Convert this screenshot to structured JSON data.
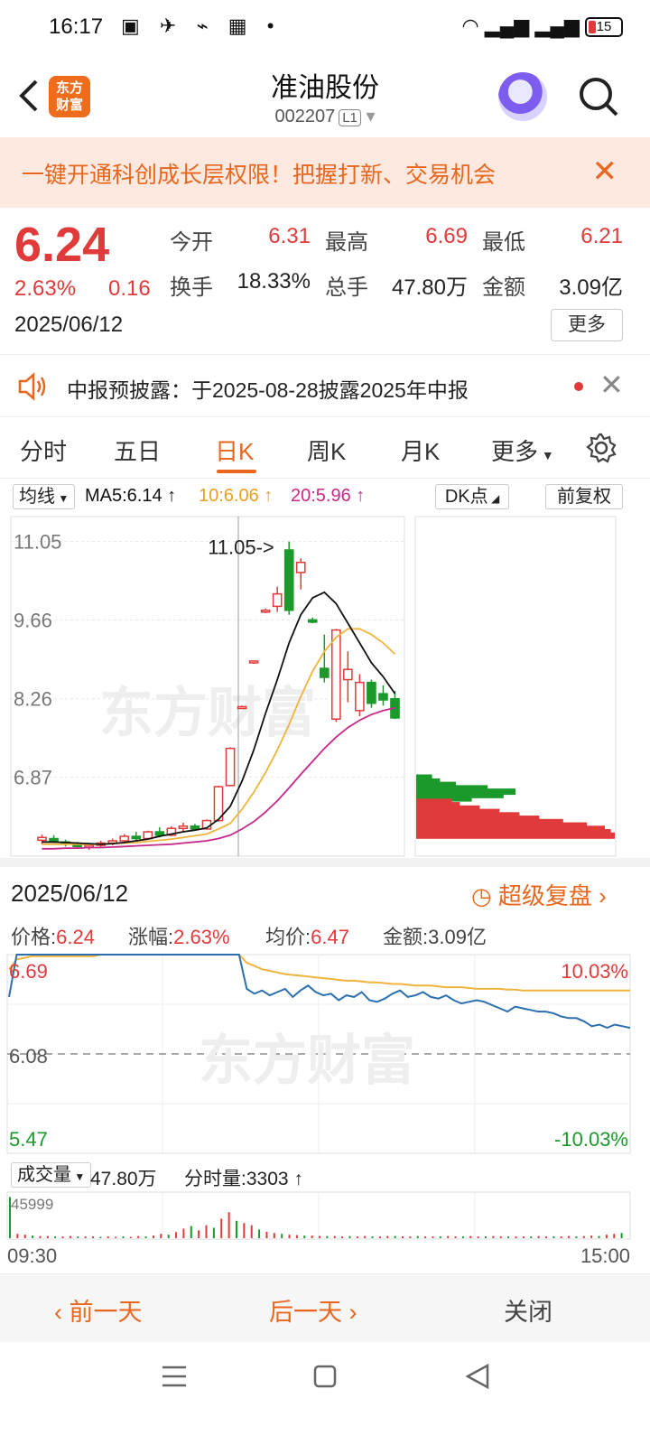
{
  "status_bar": {
    "time": "16:17",
    "battery": "15"
  },
  "header": {
    "title": "准油股份",
    "code": "002207",
    "level": "L1",
    "logo_text": "东方财富"
  },
  "banner": {
    "text": "一键开通科创成长层权限！把握打新、交易机会"
  },
  "quote": {
    "price": "6.24",
    "change_pct": "2.63%",
    "change": "0.16",
    "date": "2025/06/12",
    "open_label": "今开",
    "open": "6.31",
    "high_label": "最高",
    "high": "6.69",
    "low_label": "最低",
    "low": "6.21",
    "turnover_label": "换手",
    "turnover": "18.33%",
    "volume_label": "总手",
    "volume": "47.80万",
    "amount_label": "金额",
    "amount": "3.09亿",
    "more": "更多"
  },
  "notice": {
    "text": "中报预披露：于2025-08-28披露2025年中报"
  },
  "tabs": [
    {
      "label": "分时"
    },
    {
      "label": "五日"
    },
    {
      "label": "日K"
    },
    {
      "label": "周K"
    },
    {
      "label": "月K"
    },
    {
      "label": "更多"
    }
  ],
  "kline_toolbar": {
    "ma_select": "均线",
    "ma5": "MA5:6.14",
    "ma10": "10:6.06",
    "ma20": "20:5.96",
    "dk": "DK点",
    "adjust": "前复权"
  },
  "colors": {
    "up": "#e03a3a",
    "down": "#1b9a2b",
    "accent": "#e8661e",
    "ma5": "#111111",
    "ma10": "#f0b43c",
    "ma20": "#c8288c"
  },
  "chart_data": [
    {
      "type": "candlestick",
      "y_ticks": [
        "11.05",
        "9.66",
        "8.26",
        "6.87"
      ],
      "max_annotation": "11.05->",
      "ylim": [
        5.5,
        11.3
      ],
      "candles": [
        {
          "o": 5.75,
          "h": 5.85,
          "l": 5.68,
          "c": 5.8
        },
        {
          "o": 5.78,
          "h": 5.84,
          "l": 5.7,
          "c": 5.72
        },
        {
          "o": 5.72,
          "h": 5.76,
          "l": 5.64,
          "c": 5.68
        },
        {
          "o": 5.68,
          "h": 5.72,
          "l": 5.6,
          "c": 5.64
        },
        {
          "o": 5.64,
          "h": 5.7,
          "l": 5.58,
          "c": 5.66
        },
        {
          "o": 5.66,
          "h": 5.74,
          "l": 5.62,
          "c": 5.7
        },
        {
          "o": 5.7,
          "h": 5.78,
          "l": 5.66,
          "c": 5.74
        },
        {
          "o": 5.74,
          "h": 5.86,
          "l": 5.7,
          "c": 5.82
        },
        {
          "o": 5.82,
          "h": 5.9,
          "l": 5.74,
          "c": 5.78
        },
        {
          "o": 5.78,
          "h": 5.92,
          "l": 5.76,
          "c": 5.9
        },
        {
          "o": 5.9,
          "h": 5.98,
          "l": 5.8,
          "c": 5.84
        },
        {
          "o": 5.84,
          "h": 6.0,
          "l": 5.82,
          "c": 5.96
        },
        {
          "o": 5.96,
          "h": 6.06,
          "l": 5.9,
          "c": 6.0
        },
        {
          "o": 6.0,
          "h": 6.04,
          "l": 5.92,
          "c": 5.95
        },
        {
          "o": 5.95,
          "h": 6.12,
          "l": 5.94,
          "c": 6.1
        },
        {
          "o": 6.1,
          "h": 6.72,
          "l": 6.08,
          "c": 6.7
        },
        {
          "o": 6.72,
          "h": 7.4,
          "l": 6.72,
          "c": 7.38
        },
        {
          "o": 8.12,
          "h": 8.14,
          "l": 8.1,
          "c": 8.12
        },
        {
          "o": 8.9,
          "h": 8.94,
          "l": 8.88,
          "c": 8.93
        },
        {
          "o": 9.8,
          "h": 9.86,
          "l": 9.78,
          "c": 9.83
        },
        {
          "o": 9.9,
          "h": 10.25,
          "l": 9.8,
          "c": 10.12
        },
        {
          "o": 10.9,
          "h": 11.05,
          "l": 9.75,
          "c": 9.83
        },
        {
          "o": 10.5,
          "h": 10.75,
          "l": 10.2,
          "c": 10.68
        },
        {
          "o": 9.66,
          "h": 9.7,
          "l": 9.6,
          "c": 9.62
        },
        {
          "o": 8.8,
          "h": 9.4,
          "l": 8.55,
          "c": 8.64
        },
        {
          "o": 7.9,
          "h": 9.5,
          "l": 7.85,
          "c": 9.48
        },
        {
          "o": 8.6,
          "h": 9.1,
          "l": 8.2,
          "c": 8.78
        },
        {
          "o": 8.05,
          "h": 8.7,
          "l": 7.95,
          "c": 8.55
        },
        {
          "o": 8.55,
          "h": 8.6,
          "l": 8.1,
          "c": 8.18
        },
        {
          "o": 8.35,
          "h": 8.5,
          "l": 8.14,
          "c": 8.24
        },
        {
          "o": 8.26,
          "h": 8.4,
          "l": 7.9,
          "c": 7.92
        }
      ],
      "ma5": [
        5.72,
        5.72,
        5.71,
        5.7,
        5.69,
        5.68,
        5.69,
        5.71,
        5.74,
        5.77,
        5.82,
        5.86,
        5.9,
        5.93,
        5.97,
        6.12,
        6.35,
        6.8,
        7.35,
        8.0,
        8.6,
        9.25,
        9.75,
        10.05,
        10.15,
        9.95,
        9.6,
        9.25,
        8.9,
        8.65,
        8.35
      ],
      "ma10": [
        5.68,
        5.68,
        5.68,
        5.68,
        5.68,
        5.68,
        5.69,
        5.7,
        5.71,
        5.73,
        5.75,
        5.77,
        5.8,
        5.83,
        5.86,
        5.95,
        6.05,
        6.3,
        6.6,
        6.95,
        7.35,
        7.8,
        8.3,
        8.75,
        9.1,
        9.35,
        9.5,
        9.5,
        9.4,
        9.25,
        9.05
      ],
      "ma20": [
        5.6,
        5.6,
        5.61,
        5.61,
        5.62,
        5.62,
        5.63,
        5.64,
        5.65,
        5.66,
        5.67,
        5.68,
        5.7,
        5.72,
        5.74,
        5.78,
        5.84,
        5.95,
        6.08,
        6.25,
        6.45,
        6.68,
        6.92,
        7.15,
        7.38,
        7.58,
        7.75,
        7.88,
        7.98,
        8.05,
        8.1
      ]
    },
    {
      "type": "line",
      "price_label": "价格:",
      "price": "6.24",
      "change_label": "涨幅:",
      "change": "2.63%",
      "avg_label": "均价:",
      "avg": "6.47",
      "amount_label": "金额:",
      "amount": "3.09亿",
      "y_left": [
        "6.69",
        "6.08",
        "5.47"
      ],
      "y_right": [
        "10.03%",
        "-10.03%"
      ],
      "ylim": [
        5.47,
        6.69
      ],
      "x_start": "09:30",
      "x_end": "15:00",
      "price_series": [
        6.43,
        6.69,
        6.69,
        6.69,
        6.69,
        6.69,
        6.69,
        6.69,
        6.69,
        6.69,
        6.69,
        6.69,
        6.69,
        6.69,
        6.69,
        6.69,
        6.69,
        6.69,
        6.69,
        6.69,
        6.69,
        6.69,
        6.69,
        6.69,
        6.69,
        6.69,
        6.69,
        6.69,
        6.69,
        6.69,
        6.69,
        6.48,
        6.45,
        6.47,
        6.44,
        6.46,
        6.48,
        6.43,
        6.47,
        6.5,
        6.46,
        6.44,
        6.45,
        6.41,
        6.44,
        6.43,
        6.46,
        6.41,
        6.4,
        6.42,
        6.45,
        6.47,
        6.43,
        6.44,
        6.46,
        6.43,
        6.42,
        6.44,
        6.41,
        6.39,
        6.4,
        6.41,
        6.4,
        6.38,
        6.36,
        6.34,
        6.37,
        6.36,
        6.35,
        6.34,
        6.34,
        6.33,
        6.31,
        6.3,
        6.3,
        6.28,
        6.25,
        6.26,
        6.24,
        6.26,
        6.25,
        6.24
      ],
      "avg_series": [
        6.6,
        6.66,
        6.67,
        6.68,
        6.68,
        6.68,
        6.68,
        6.68,
        6.68,
        6.68,
        6.68,
        6.68,
        6.69,
        6.69,
        6.69,
        6.69,
        6.69,
        6.69,
        6.69,
        6.69,
        6.69,
        6.69,
        6.69,
        6.69,
        6.69,
        6.69,
        6.69,
        6.69,
        6.69,
        6.69,
        6.69,
        6.64,
        6.62,
        6.6,
        6.59,
        6.58,
        6.57,
        6.565,
        6.56,
        6.555,
        6.55,
        6.545,
        6.54,
        6.535,
        6.53,
        6.53,
        6.525,
        6.52,
        6.52,
        6.515,
        6.51,
        6.51,
        6.505,
        6.5,
        6.5,
        6.5,
        6.495,
        6.49,
        6.49,
        6.49,
        6.485,
        6.48,
        6.48,
        6.48,
        6.48,
        6.475,
        6.475,
        6.47,
        6.47,
        6.47,
        6.47,
        6.47,
        6.47,
        6.47,
        6.47,
        6.47,
        6.47,
        6.47,
        6.47,
        6.47,
        6.47,
        6.47
      ]
    },
    {
      "type": "bar",
      "select": "成交量",
      "total": "47.80万",
      "tick_label": "分时量:3303",
      "max_label": "45999",
      "values": [
        0.95,
        0.1,
        0.08,
        0.06,
        0.05,
        0.05,
        0.04,
        0.04,
        0.05,
        0.04,
        0.04,
        0.04,
        0.03,
        0.04,
        0.03,
        0.04,
        0.03,
        0.05,
        0.04,
        0.06,
        0.1,
        0.08,
        0.14,
        0.22,
        0.28,
        0.18,
        0.3,
        0.24,
        0.45,
        0.6,
        0.4,
        0.35,
        0.3,
        0.2,
        0.15,
        0.12,
        0.1,
        0.08,
        0.07,
        0.06,
        0.06,
        0.05,
        0.05,
        0.05,
        0.04,
        0.05,
        0.04,
        0.05,
        0.04,
        0.04,
        0.05,
        0.05,
        0.04,
        0.04,
        0.05,
        0.04,
        0.04,
        0.04,
        0.05,
        0.04,
        0.04,
        0.05,
        0.04,
        0.04,
        0.05,
        0.04,
        0.04,
        0.04,
        0.04,
        0.04,
        0.05,
        0.04,
        0.04,
        0.04,
        0.05,
        0.04,
        0.05,
        0.06,
        0.05,
        0.08,
        0.1,
        0.12
      ]
    }
  ],
  "actions": {
    "prev": "前一天",
    "next": "后一天",
    "close": "关闭"
  }
}
